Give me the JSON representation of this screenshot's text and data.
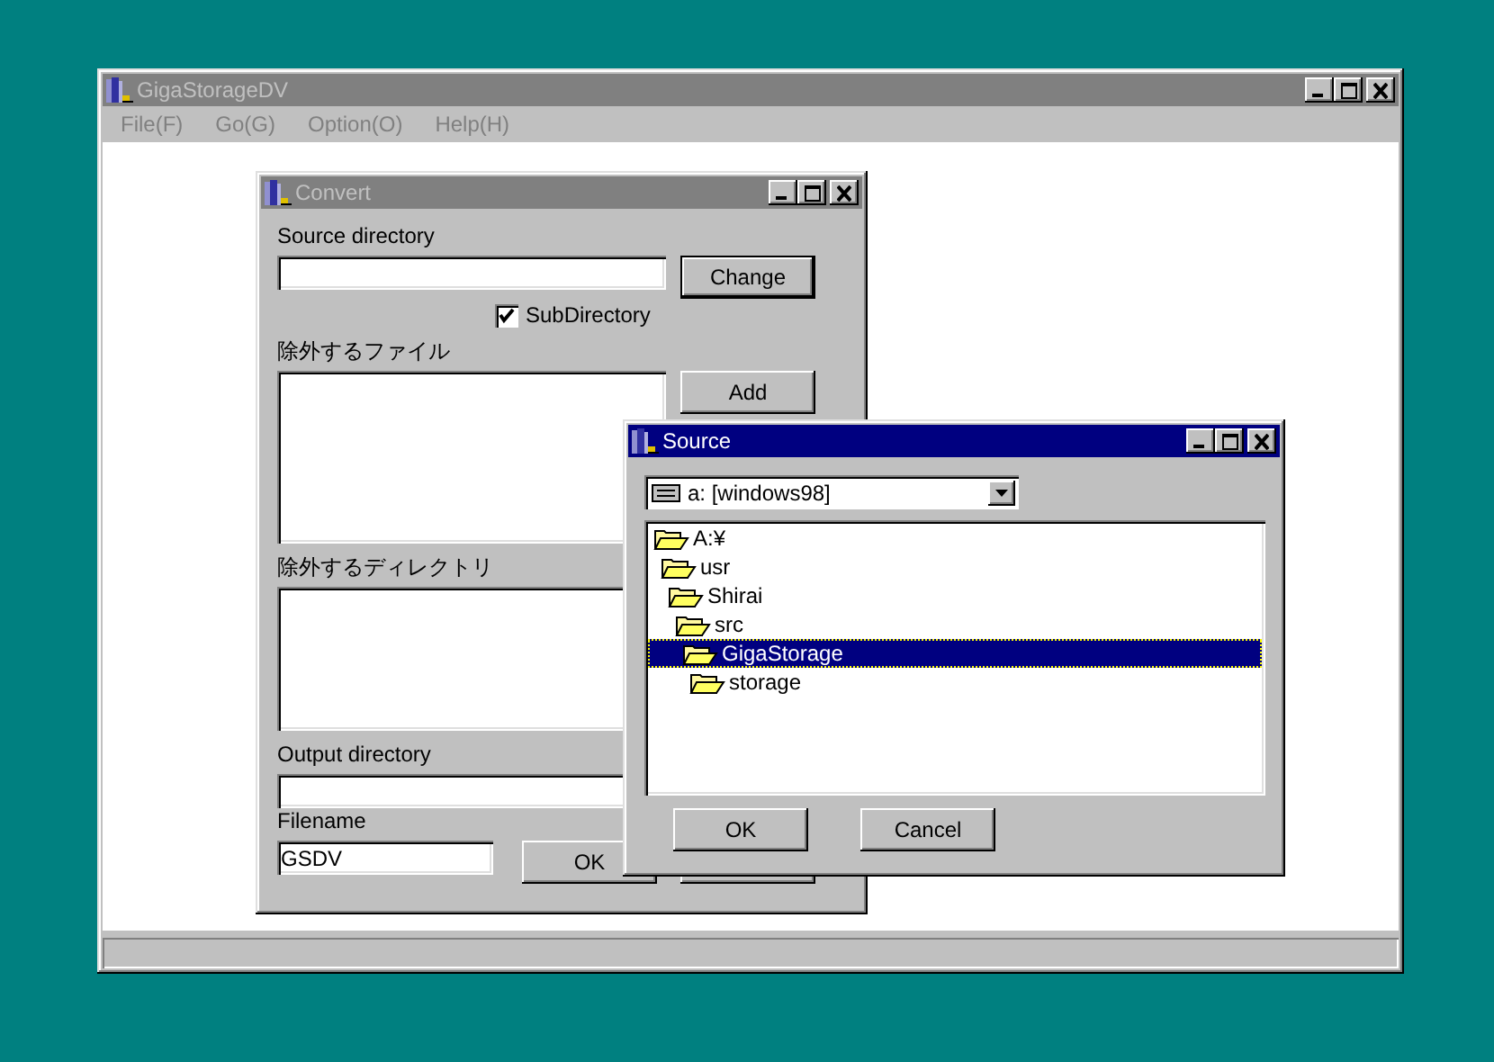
{
  "main_window": {
    "title": "GigaStorageDV",
    "active": false,
    "menu": [
      "File(F)",
      "Go(G)",
      "Option(O)",
      "Help(H)"
    ]
  },
  "convert_dialog": {
    "title": "Convert",
    "active": false,
    "source_label": "Source directory",
    "change_button": "Change",
    "subdirectory": {
      "label": "SubDirectory",
      "checked": true
    },
    "exclude_files_label": "除外するファイル",
    "add_button": "Add",
    "exclude_dirs_label": "除外するディレクトリ",
    "output_label": "Output directory",
    "filename_label": "Filename",
    "filename_value": "GSDV",
    "ok_button": "OK"
  },
  "source_dialog": {
    "title": "Source",
    "active": true,
    "drive": "a: [windows98]",
    "tree": [
      {
        "label": "A:¥",
        "selected": false,
        "children": [
          {
            "label": "usr",
            "selected": false,
            "children": [
              {
                "label": "Shirai",
                "selected": false,
                "children": [
                  {
                    "label": "src",
                    "selected": false,
                    "children": [
                      {
                        "label": "GigaStorage",
                        "selected": true,
                        "children": [
                          {
                            "label": "storage",
                            "selected": false
                          }
                        ]
                      }
                    ]
                  }
                ]
              }
            ]
          }
        ]
      }
    ],
    "buttons": [
      "OK",
      "Cancel"
    ]
  }
}
